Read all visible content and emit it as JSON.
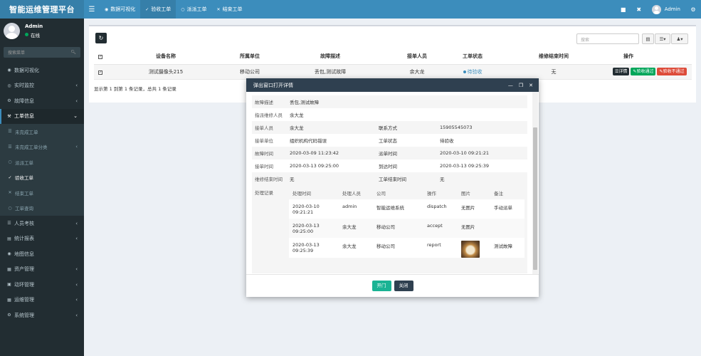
{
  "app": {
    "title": "智能运维管理平台"
  },
  "user": {
    "name": "Admin",
    "status": "在线"
  },
  "sidebar": {
    "search_placeholder": "搜索菜单",
    "items": [
      {
        "label": "数据可视化",
        "icon": "dashboard-icon"
      },
      {
        "label": "实时监控",
        "icon": "monitor-icon",
        "has_children": true
      },
      {
        "label": "故障信息",
        "icon": "bug-icon",
        "has_children": true
      },
      {
        "label": "工单信息",
        "icon": "wrench-icon",
        "expanded": true,
        "children": [
          {
            "label": "未完成工单",
            "icon": "list-icon"
          },
          {
            "label": "未完成工单分类",
            "icon": "list-icon",
            "has_children": true
          },
          {
            "label": "派派工单",
            "icon": "circle-icon"
          },
          {
            "label": "验收工单",
            "icon": "check-icon",
            "current": true
          },
          {
            "label": "结束工单",
            "icon": "close-icon"
          },
          {
            "label": "工单查询",
            "icon": "circle-icon"
          }
        ]
      },
      {
        "label": "人员考核",
        "icon": "users-icon",
        "has_children": true
      },
      {
        "label": "统计报表",
        "icon": "chart-icon",
        "has_children": true
      },
      {
        "label": "地图信息",
        "icon": "map-icon"
      },
      {
        "label": "资产管理",
        "icon": "asset-icon",
        "has_children": true
      },
      {
        "label": "动环管理",
        "icon": "power-icon",
        "has_children": true
      },
      {
        "label": "运维管理",
        "icon": "cog-icon",
        "has_children": true
      },
      {
        "label": "系统管理",
        "icon": "cogs-icon",
        "has_children": true
      }
    ]
  },
  "header": {
    "tabs": [
      {
        "label": "数据可视化",
        "icon": "dashboard-icon"
      },
      {
        "label": "验收工单",
        "icon": "check-icon",
        "active": true
      },
      {
        "label": "派派工单",
        "icon": "circle-icon"
      },
      {
        "label": "结束工单",
        "icon": "close-icon"
      }
    ],
    "user": "Admin"
  },
  "toolbar": {
    "refresh_icon": "refresh-icon",
    "search_placeholder": "搜索"
  },
  "table": {
    "columns": [
      "设备名称",
      "所属单位",
      "故障描述",
      "接单人员",
      "工单状态",
      "维修结束时间",
      "操作"
    ],
    "rows": [
      {
        "device": "测试摄像头215",
        "unit": "移动公司",
        "fault": "丢包,测试故障",
        "receiver": "余大龙",
        "status": "待验收",
        "end_time": "无"
      }
    ],
    "actions": {
      "detail": "详情",
      "pass": "验收通过",
      "fail": "验收不通过"
    },
    "pagination": "显示第 1 到第 1 条记录，总共 1 条记录"
  },
  "modal": {
    "title": "弹出窗口打开详情",
    "fields": {
      "fault_desc_label": "故障描述",
      "fault_desc": "丢包,测试故障",
      "dispatcher_label": "指派维修人员",
      "dispatcher": "余大龙",
      "receiver_label": "接单人员",
      "receiver": "余大龙",
      "contact_label": "联系方式",
      "contact": "15905545073",
      "unit_label": "接单单位",
      "unit": "组织机构代码错误",
      "status_label": "工单状态",
      "status": "待验收",
      "fault_time_label": "故障时间",
      "fault_time": "2020-03-09 11:23:42",
      "dispatch_time_label": "派单时间",
      "dispatch_time": "2020-03-10 09:21:21",
      "accept_time_label": "接单时间",
      "accept_time": "2020-03-13 09:25:00",
      "arrive_time_label": "到达时间",
      "arrive_time": "2020-03-13 09:25:39",
      "repair_end_label": "维修结束时间",
      "repair_end": "无",
      "order_end_label": "工单结束时间",
      "order_end": "无",
      "records_label": "处理记录"
    },
    "records": {
      "columns": [
        "处理时间",
        "处理人员",
        "公司",
        "操作",
        "图片",
        "备注"
      ],
      "rows": [
        {
          "time1": "2020-03-10",
          "time2": "09:21:21",
          "person": "admin",
          "company": "智能运维系统",
          "action": "dispatch",
          "image": "无图片",
          "note": "手动派单"
        },
        {
          "time1": "2020-03-13",
          "time2": "09:25:00",
          "person": "余大龙",
          "company": "移动公司",
          "action": "accept",
          "image": "无图片",
          "note": ""
        },
        {
          "time1": "2020-03-13",
          "time2": "09:25:39",
          "person": "余大龙",
          "company": "移动公司",
          "action": "report",
          "image": "",
          "note": "测试故障"
        }
      ]
    },
    "buttons": {
      "open": "开门",
      "close": "关闭"
    }
  }
}
